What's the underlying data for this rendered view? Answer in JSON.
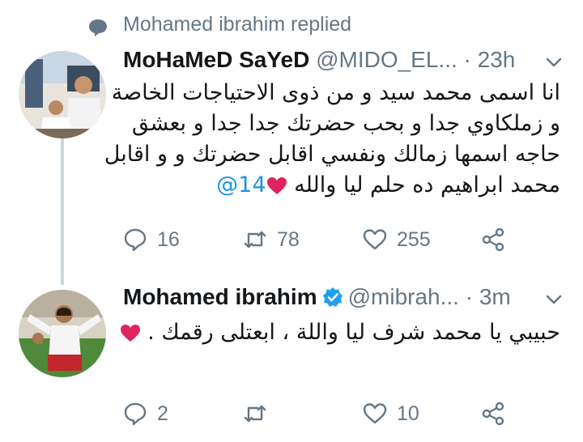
{
  "context": {
    "text": "Mohamed ibrahim replied",
    "icon": "reply-bubble-icon"
  },
  "tweets": [
    {
      "name": "MoHaMeD SaYeD",
      "handle": "@MIDO_EL...",
      "dot": "·",
      "time": "23h",
      "verified": false,
      "lines": [
        "انا اسمى محمد سيد و من ذوى الاحتياجات الخاصة",
        "و زملكاوي جدا و بحب حضرتك جدا جدا و بعشق",
        "حاجه اسمها زمالك ونفسي اقابل حضرتك و و اقابل",
        "محمد ابراهيم ده حلم ليا والله"
      ],
      "mention": "@14",
      "actions": {
        "replies": "16",
        "retweets": "78",
        "likes": "255"
      }
    },
    {
      "name": "Mohamed ibrahim",
      "handle": "@mibrah...",
      "dot": "·",
      "time": "3m",
      "verified": true,
      "lines": [
        "حبيبي يا محمد شرف ليا واللة ، ابعتلى رقمك ."
      ],
      "actions": {
        "replies": "2",
        "retweets": "",
        "likes": "10"
      }
    }
  ],
  "colors": {
    "muted": "#657786",
    "link": "#1b95e0",
    "verified": "#1da1f2",
    "heart": "#e0245e",
    "thread": "#ccd6dd"
  }
}
